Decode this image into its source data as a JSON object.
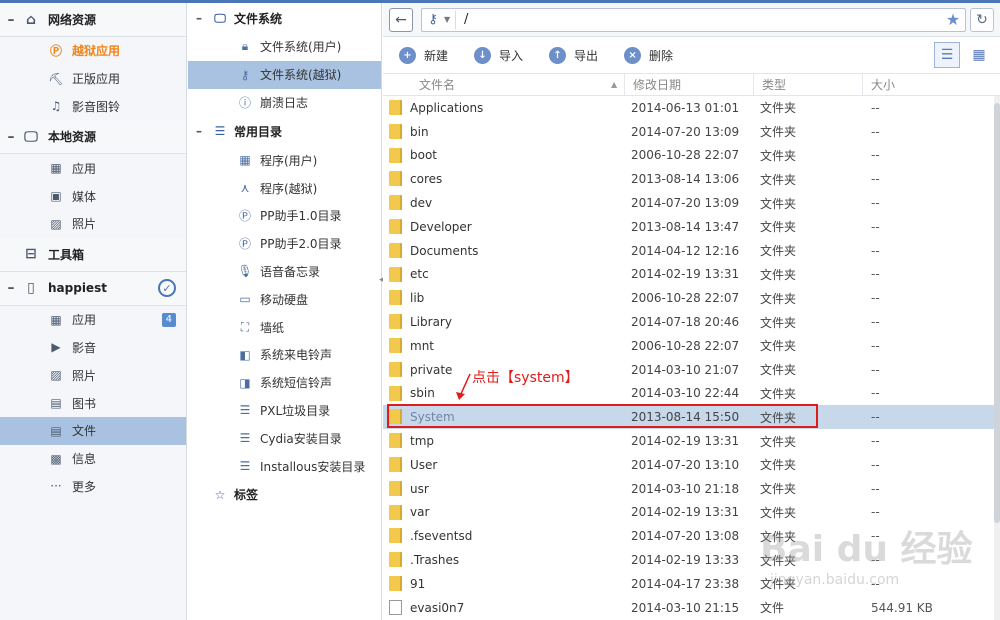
{
  "sidebar": {
    "network": {
      "title": "网络资源",
      "items": [
        {
          "label": "越狱应用"
        },
        {
          "label": "正版应用"
        },
        {
          "label": "影音图铃"
        }
      ]
    },
    "local": {
      "title": "本地资源",
      "items": [
        {
          "label": "应用"
        },
        {
          "label": "媒体"
        },
        {
          "label": "照片"
        }
      ]
    },
    "toolbox": {
      "title": "工具箱"
    },
    "device": {
      "title": "happiest",
      "items": [
        {
          "label": "应用",
          "badge": "4"
        },
        {
          "label": "影音"
        },
        {
          "label": "照片"
        },
        {
          "label": "图书"
        },
        {
          "label": "文件"
        },
        {
          "label": "信息"
        },
        {
          "label": "更多"
        }
      ]
    }
  },
  "tree": {
    "filesystem": {
      "title": "文件系统",
      "items": [
        {
          "label": "文件系统(用户)"
        },
        {
          "label": "文件系统(越狱)"
        },
        {
          "label": "崩溃日志"
        }
      ]
    },
    "common": {
      "title": "常用目录",
      "items": [
        {
          "label": "程序(用户)"
        },
        {
          "label": "程序(越狱)"
        },
        {
          "label": "PP助手1.0目录"
        },
        {
          "label": "PP助手2.0目录"
        },
        {
          "label": "语音备忘录"
        },
        {
          "label": "移动硬盘"
        },
        {
          "label": "墙纸"
        },
        {
          "label": "系统来电铃声"
        },
        {
          "label": "系统短信铃声"
        },
        {
          "label": "PXL垃圾目录"
        },
        {
          "label": "Cydia安装目录"
        },
        {
          "label": "Installous安装目录"
        }
      ]
    },
    "tags": {
      "title": "标签"
    }
  },
  "address": {
    "path": "/"
  },
  "toolbar": {
    "new_label": "新建",
    "import_label": "导入",
    "export_label": "导出",
    "delete_label": "删除"
  },
  "columns": {
    "name": "文件名",
    "date": "修改日期",
    "type": "类型",
    "size": "大小"
  },
  "files": [
    {
      "name": "Applications",
      "date": "2014-06-13 01:01",
      "type": "文件夹",
      "size": "--",
      "kind": "folder"
    },
    {
      "name": "bin",
      "date": "2014-07-20 13:09",
      "type": "文件夹",
      "size": "--",
      "kind": "folder"
    },
    {
      "name": "boot",
      "date": "2006-10-28 22:07",
      "type": "文件夹",
      "size": "--",
      "kind": "folder"
    },
    {
      "name": "cores",
      "date": "2013-08-14 13:06",
      "type": "文件夹",
      "size": "--",
      "kind": "folder"
    },
    {
      "name": "dev",
      "date": "2014-07-20 13:09",
      "type": "文件夹",
      "size": "--",
      "kind": "folder"
    },
    {
      "name": "Developer",
      "date": "2013-08-14 13:47",
      "type": "文件夹",
      "size": "--",
      "kind": "folder"
    },
    {
      "name": "Documents",
      "date": "2014-04-12 12:16",
      "type": "文件夹",
      "size": "--",
      "kind": "folder"
    },
    {
      "name": "etc",
      "date": "2014-02-19 13:31",
      "type": "文件夹",
      "size": "--",
      "kind": "folder"
    },
    {
      "name": "lib",
      "date": "2006-10-28 22:07",
      "type": "文件夹",
      "size": "--",
      "kind": "folder"
    },
    {
      "name": "Library",
      "date": "2014-07-18 20:46",
      "type": "文件夹",
      "size": "--",
      "kind": "folder"
    },
    {
      "name": "mnt",
      "date": "2006-10-28 22:07",
      "type": "文件夹",
      "size": "--",
      "kind": "folder"
    },
    {
      "name": "private",
      "date": "2014-03-10 21:07",
      "type": "文件夹",
      "size": "--",
      "kind": "folder"
    },
    {
      "name": "sbin",
      "date": "2014-03-10 22:44",
      "type": "文件夹",
      "size": "--",
      "kind": "folder"
    },
    {
      "name": "System",
      "date": "2013-08-14 15:50",
      "type": "文件夹",
      "size": "--",
      "kind": "folder",
      "selected": true
    },
    {
      "name": "tmp",
      "date": "2014-02-19 13:31",
      "type": "文件夹",
      "size": "--",
      "kind": "folder"
    },
    {
      "name": "User",
      "date": "2014-07-20 13:10",
      "type": "文件夹",
      "size": "--",
      "kind": "folder"
    },
    {
      "name": "usr",
      "date": "2014-03-10 21:18",
      "type": "文件夹",
      "size": "--",
      "kind": "folder"
    },
    {
      "name": "var",
      "date": "2014-02-19 13:31",
      "type": "文件夹",
      "size": "--",
      "kind": "folder"
    },
    {
      "name": ".fseventsd",
      "date": "2014-07-20 13:08",
      "type": "文件夹",
      "size": "--",
      "kind": "folder"
    },
    {
      "name": ".Trashes",
      "date": "2014-02-19 13:33",
      "type": "文件夹",
      "size": "--",
      "kind": "folder"
    },
    {
      "name": "91",
      "date": "2014-04-17 23:38",
      "type": "文件夹",
      "size": "--",
      "kind": "folder"
    },
    {
      "name": "evasi0n7",
      "date": "2014-03-10 21:15",
      "type": "文件",
      "size": "544.91 KB",
      "kind": "file"
    }
  ],
  "annotation": {
    "text": "点击【system】",
    "color": "#e01b1b"
  },
  "watermark": {
    "logo": "Bai du 经验",
    "url": "jingyan.baidu.com"
  },
  "colors": {
    "accent": "#4a76b8",
    "selection": "#a9c2e2",
    "highlight": "#f08519"
  }
}
